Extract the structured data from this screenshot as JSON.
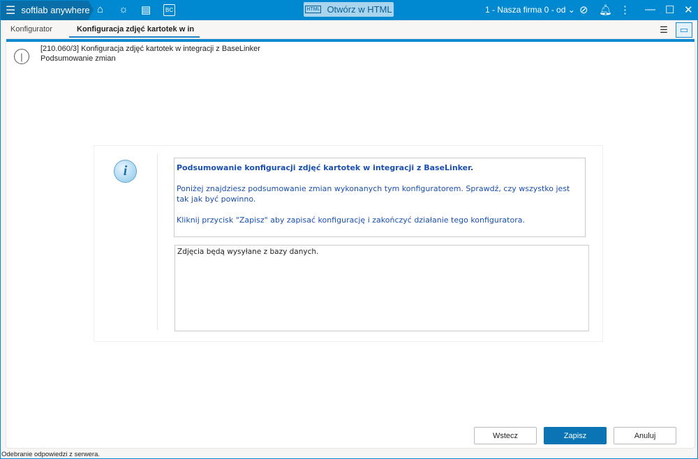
{
  "app": {
    "name": "softlab anywhere",
    "open_html": "Otwórz w HTML",
    "html_icon_label": "HTML",
    "company": "1 - Nasza firma 0 - od"
  },
  "tabs": [
    {
      "label": "Konfigurator"
    },
    {
      "label": "Konfiguracja zdjęć kartotek w in"
    }
  ],
  "header": {
    "title": "[210.060/3] Konfiguracja zdjęć kartotek w integracji z BaseLinker",
    "subtitle": "Podsumowanie zmian"
  },
  "message": {
    "title": "Podsumowanie konfiguracji zdjęć kartotek w integracji z BaseLinker.",
    "p1": "Poniżej znajdziesz podsumowanie zmian wykonanych tym konfiguratorem. Sprawdź, czy wszystko jest tak jak być powinno.",
    "p2": "Kliknij przycisk \"Zapisz\" aby zapisać konfigurację i zakończyć działanie tego konfiguratora."
  },
  "summary": "Zdjęcia będą wysyłane z bazy danych.",
  "buttons": {
    "back": "Wstecz",
    "save": "Zapisz",
    "cancel": "Anuluj"
  },
  "status": "Odebranie odpowiedzi z serwera.",
  "colors": {
    "titlebar": "#0088d0",
    "primary": "#0a74b5",
    "message_text": "#1a4fb0"
  }
}
